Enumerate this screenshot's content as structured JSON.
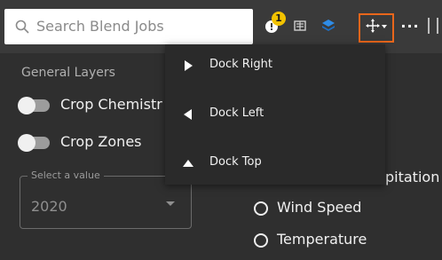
{
  "search": {
    "placeholder": "Search Blend Jobs"
  },
  "toolbar": {
    "badge_count": "1",
    "icons": [
      "notification-icon",
      "scale-icon",
      "layers-icon",
      "dock-move-icon",
      "more-icon"
    ],
    "more_label": "···",
    "accent": "#e8661b"
  },
  "panel": {
    "section_title": "General Layers",
    "layers": [
      {
        "label": "Crop Chemistr"
      },
      {
        "label": "Crop Zones"
      }
    ],
    "select": {
      "legend": "Select a value",
      "value": "2020"
    },
    "radios": [
      {
        "label": "Wind Speed"
      },
      {
        "label": "Temperature"
      }
    ],
    "cut_off_label": "pitation"
  },
  "dock_menu": {
    "items": [
      {
        "label": "Dock Right",
        "icon": "triangle-right-icon"
      },
      {
        "label": "Dock Left",
        "icon": "triangle-left-icon"
      },
      {
        "label": "Dock Top",
        "icon": "triangle-up-icon"
      }
    ]
  }
}
